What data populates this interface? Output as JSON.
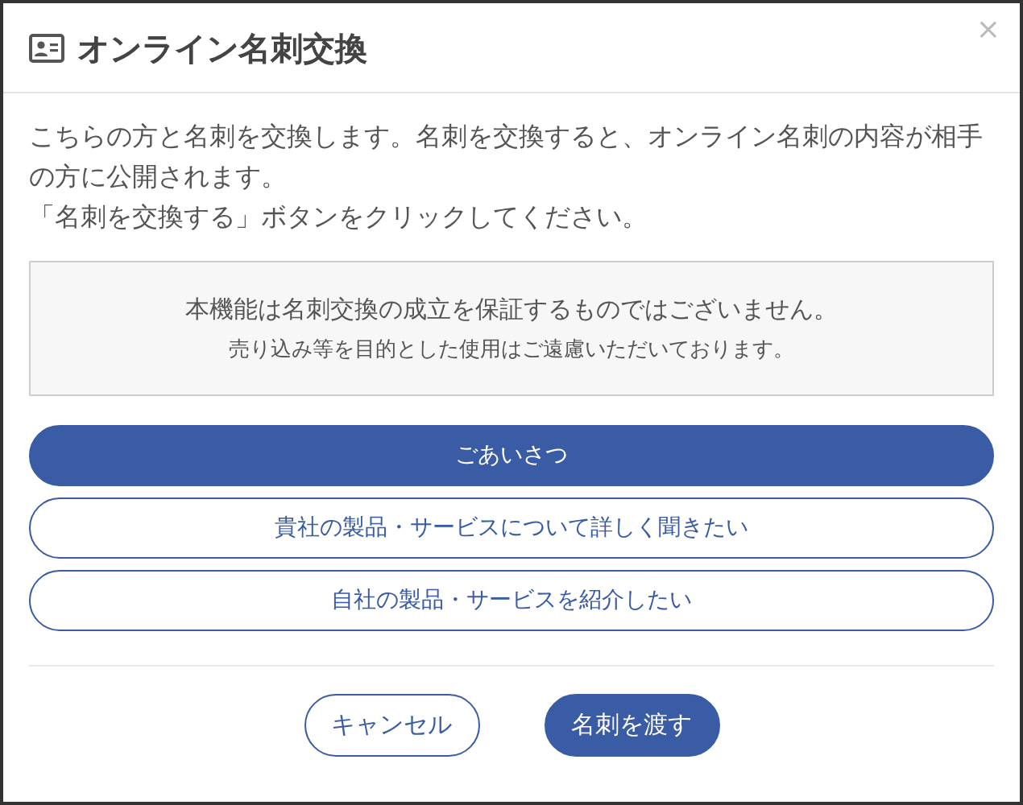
{
  "dialog": {
    "title": "オンライン名刺交換",
    "close": "×"
  },
  "message": [
    "こちらの方と名刺を交換します。名刺を交換すると、オンライン名刺の内容が相手の方に公開されます。",
    "「名刺を交換する」ボタンをクリックしてください。"
  ],
  "notice": {
    "main": "本機能は名刺交換の成立を保証するものではございません。",
    "sub": "売り込み等を目的とした使用はご遠慮いただいております。"
  },
  "options": [
    {
      "label": "ごあいさつ",
      "selected": true
    },
    {
      "label": "貴社の製品・サービスについて詳しく聞きたい",
      "selected": false
    },
    {
      "label": "自社の製品・サービスを紹介したい",
      "selected": false
    }
  ],
  "buttons": [
    {
      "label": "キャンセル",
      "kind": "secondary"
    },
    {
      "label": "名刺を渡す",
      "kind": "primary"
    }
  ]
}
